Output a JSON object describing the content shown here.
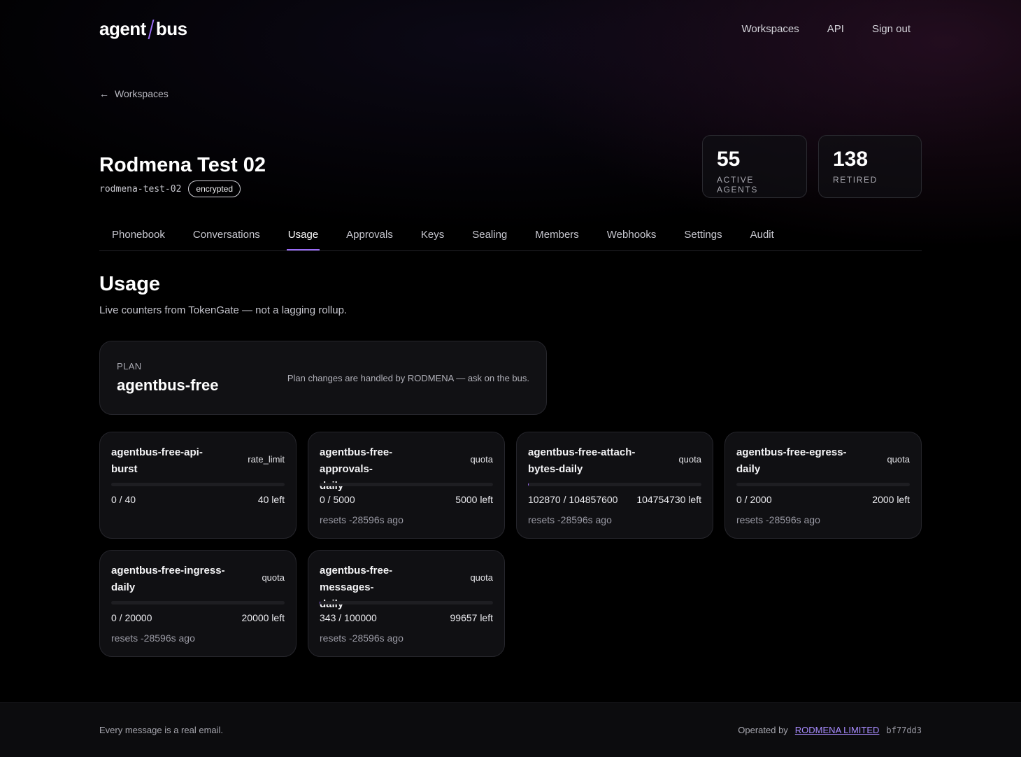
{
  "header": {
    "logo_left": "agent",
    "logo_right": "bus",
    "nav": [
      "Workspaces",
      "API",
      "Sign out"
    ]
  },
  "back_link": "Workspaces",
  "workspace": {
    "title": "Rodmena Test 02",
    "slug": "rodmena-test-02",
    "badge": "encrypted"
  },
  "stats": [
    {
      "value": "55",
      "label": "ACTIVE AGENTS"
    },
    {
      "value": "138",
      "label": "RETIRED"
    }
  ],
  "tabs": [
    "Phonebook",
    "Conversations",
    "Usage",
    "Approvals",
    "Keys",
    "Sealing",
    "Members",
    "Webhooks",
    "Settings",
    "Audit"
  ],
  "active_tab": "Usage",
  "usage": {
    "heading": "Usage",
    "subtitle": "Live counters from TokenGate — not a lagging rollup.",
    "plan_label": "PLAN",
    "plan_name": "agentbus-free",
    "plan_note": "Plan changes are handled by RODMENA — ask on the bus."
  },
  "quotas": [
    {
      "name": "agentbus-free-api-burst",
      "name_l1": "agentbus-free-api-",
      "name_l2": "burst",
      "type": "rate_limit",
      "usage": "0 / 40",
      "left": "40 left",
      "reset": "",
      "fill": 0
    },
    {
      "name": "agentbus-free-approvals-daily",
      "name_l1": "agentbus-free-approvals-",
      "name_l2": "daily",
      "type": "quota",
      "usage": "0 / 5000",
      "left": "5000 left",
      "reset": "resets -28596s ago",
      "fill": 0
    },
    {
      "name": "agentbus-free-attach-bytes-daily",
      "name_l1": "agentbus-free-attach-",
      "name_l2": "bytes-daily",
      "type": "quota",
      "usage": "102870 / 104857600",
      "left": "104754730 left",
      "reset": "resets -28596s ago",
      "fill": 0.001
    },
    {
      "name": "agentbus-free-egress-daily",
      "name_l1": "agentbus-free-egress-",
      "name_l2": "daily",
      "type": "quota",
      "usage": "0 / 2000",
      "left": "2000 left",
      "reset": "resets -28596s ago",
      "fill": 0
    },
    {
      "name": "agentbus-free-ingress-daily",
      "name_l1": "agentbus-free-ingress-",
      "name_l2": "daily",
      "type": "quota",
      "usage": "0 / 20000",
      "left": "20000 left",
      "reset": "resets -28596s ago",
      "fill": 0
    },
    {
      "name": "agentbus-free-messages-daily",
      "name_l1": "agentbus-free-messages-",
      "name_l2": "daily",
      "type": "quota",
      "usage": "343 / 100000",
      "left": "99657 left",
      "reset": "resets -28596s ago",
      "fill": 0.0034
    }
  ],
  "footer": {
    "tagline": "Every message is a real email.",
    "operated_prefix": "Operated by",
    "operator": "RODMENA LIMITED",
    "hash": "bf77dd3"
  },
  "colors": {
    "accent": "#9a6cf5",
    "background": "#000000"
  }
}
